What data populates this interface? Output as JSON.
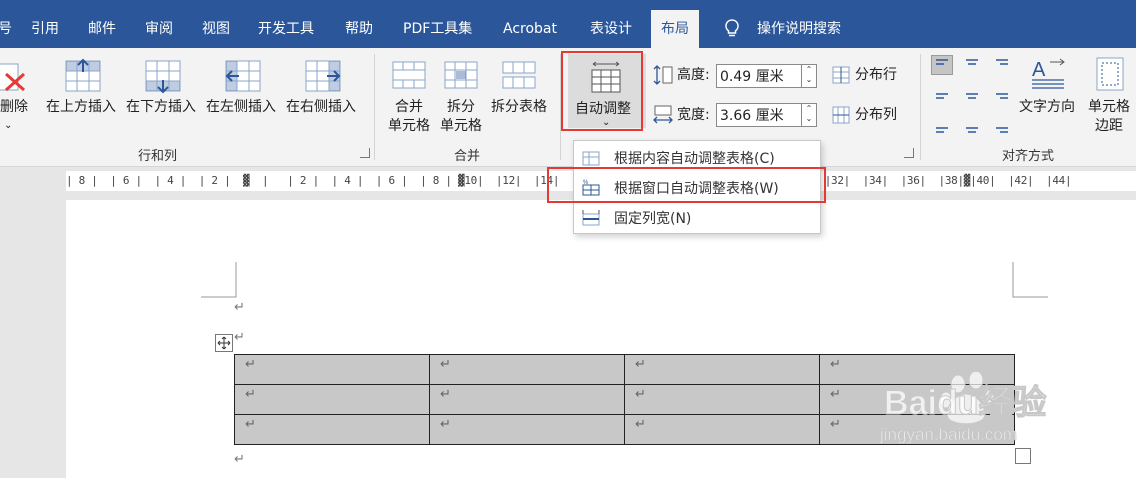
{
  "tabs": [
    "号",
    "引用",
    "邮件",
    "审阅",
    "视图",
    "开发工具",
    "帮助",
    "PDF工具集",
    "Acrobat",
    "表设计",
    "布局",
    "操作说明搜索"
  ],
  "active_tab": "布局",
  "ribbon": {
    "rows_cols": {
      "delete": "删除",
      "insert_above": "在上方插入",
      "insert_below": "在下方插入",
      "insert_left": "在左侧插入",
      "insert_right": "在右侧插入",
      "group": "行和列"
    },
    "merge": {
      "merge_cells_1": "合并",
      "merge_cells_2": "单元格",
      "split_cells_1": "拆分",
      "split_cells_2": "单元格",
      "split_table": "拆分表格",
      "group": "合并"
    },
    "cell_size": {
      "autofit": "自动调整",
      "height_label": "高度:",
      "height_value": "0.49 厘米",
      "width_label": "宽度:",
      "width_value": "3.66 厘米",
      "distribute_rows": "分布行",
      "distribute_cols": "分布列"
    },
    "alignment": {
      "text_direction": "文字方向",
      "cell_margins_1": "单元格",
      "cell_margins_2": "边距",
      "group": "对齐方式"
    }
  },
  "autofit_menu": [
    {
      "label": "根据内容自动调整表格(C)"
    },
    {
      "label": "根据窗口自动调整表格(W)"
    },
    {
      "label": "固定列宽(N)"
    }
  ],
  "ruler_text": "| 8 |  | 6 |  | 4 |  | 2 |  ▓  |   | 2 |  | 4 |  | 6 |  | 8 | ▓10|  |12|  |14|  |16|                              |30|  |32|  |34|  |36|  |38|▓|40|  |42|  |44|",
  "paragraph_mark": "↵",
  "watermark": {
    "brand": "Baidu经验",
    "url": "jingyan.baidu.com"
  },
  "colors": {
    "tabbar": "#2b579a",
    "ribbon": "#f3f3f3",
    "highlight": "#e53935",
    "table_fill": "#c8c8c8"
  }
}
